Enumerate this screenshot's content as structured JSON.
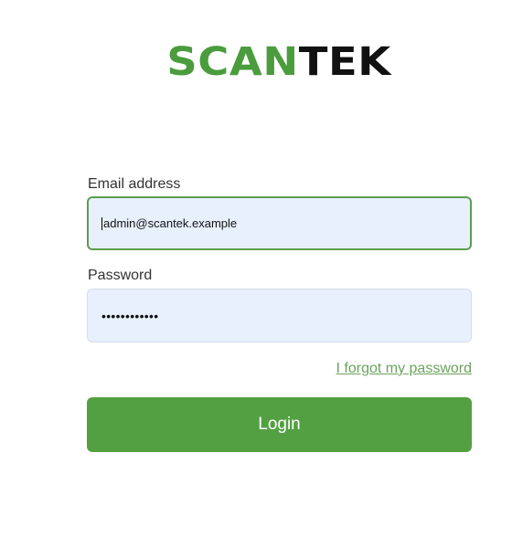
{
  "logo": {
    "part_a": "SCAN",
    "part_b": "TEK",
    "color_a": "#4a9c3c",
    "color_b": "#111111"
  },
  "form": {
    "email_label": "Email address",
    "email_value": "admin@scantek.example",
    "password_label": "Password",
    "password_masked": "••••••••••••",
    "forgot_link": "I forgot my password",
    "login_label": "Login"
  },
  "colors": {
    "accent": "#53a043",
    "input_background": "#e8f0fe"
  }
}
